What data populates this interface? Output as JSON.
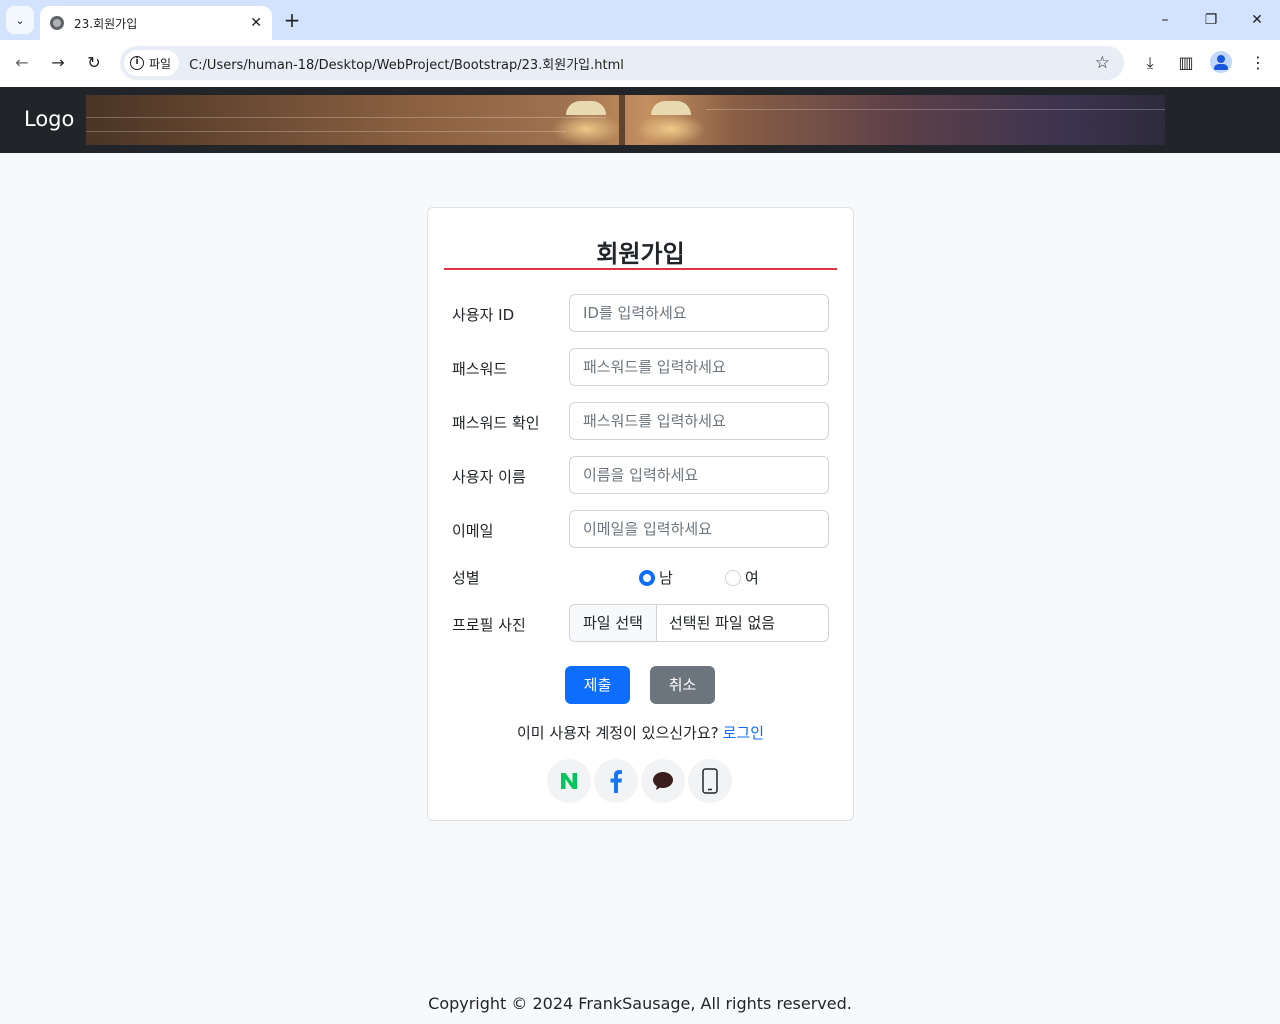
{
  "browser": {
    "tab_title": "23.회원가입",
    "chip_label": "파일",
    "url": "C:/Users/human-18/Desktop/WebProject/Bootstrap/23.회원가입.html"
  },
  "navbar": {
    "logo": "Logo"
  },
  "form": {
    "title": "회원가입",
    "fields": [
      {
        "label": "사용자 ID",
        "placeholder": "ID를 입력하세요"
      },
      {
        "label": "패스워드",
        "placeholder": "패스워드를 입력하세요"
      },
      {
        "label": "패스워드 확인",
        "placeholder": "패스워드를 입력하세요"
      },
      {
        "label": "사용자 이름",
        "placeholder": "이름을 입력하세요"
      },
      {
        "label": "이메일",
        "placeholder": "이메일을 입력하세요"
      }
    ],
    "gender": {
      "label": "성별",
      "options": [
        "남",
        "여"
      ],
      "selected": "남"
    },
    "photo": {
      "label": "프로필 사진",
      "button": "파일 선택",
      "status": "선택된 파일 없음"
    },
    "submit_label": "제출",
    "cancel_label": "취소",
    "login_prompt": "이미 사용자 계정이 있으신가요?",
    "login_link": "로그인",
    "social_icons": [
      "naver-icon",
      "facebook-icon",
      "kakao-icon",
      "phone-icon"
    ]
  },
  "footer": {
    "text": "Copyright © 2024 FrankSausage, All rights reserved."
  },
  "colors": {
    "primary": "#0d6efd",
    "secondary": "#6c757d",
    "title_rule": "#dc3545",
    "navbar": "#212529",
    "naver": "#03c75a",
    "facebook": "#1877f2"
  }
}
